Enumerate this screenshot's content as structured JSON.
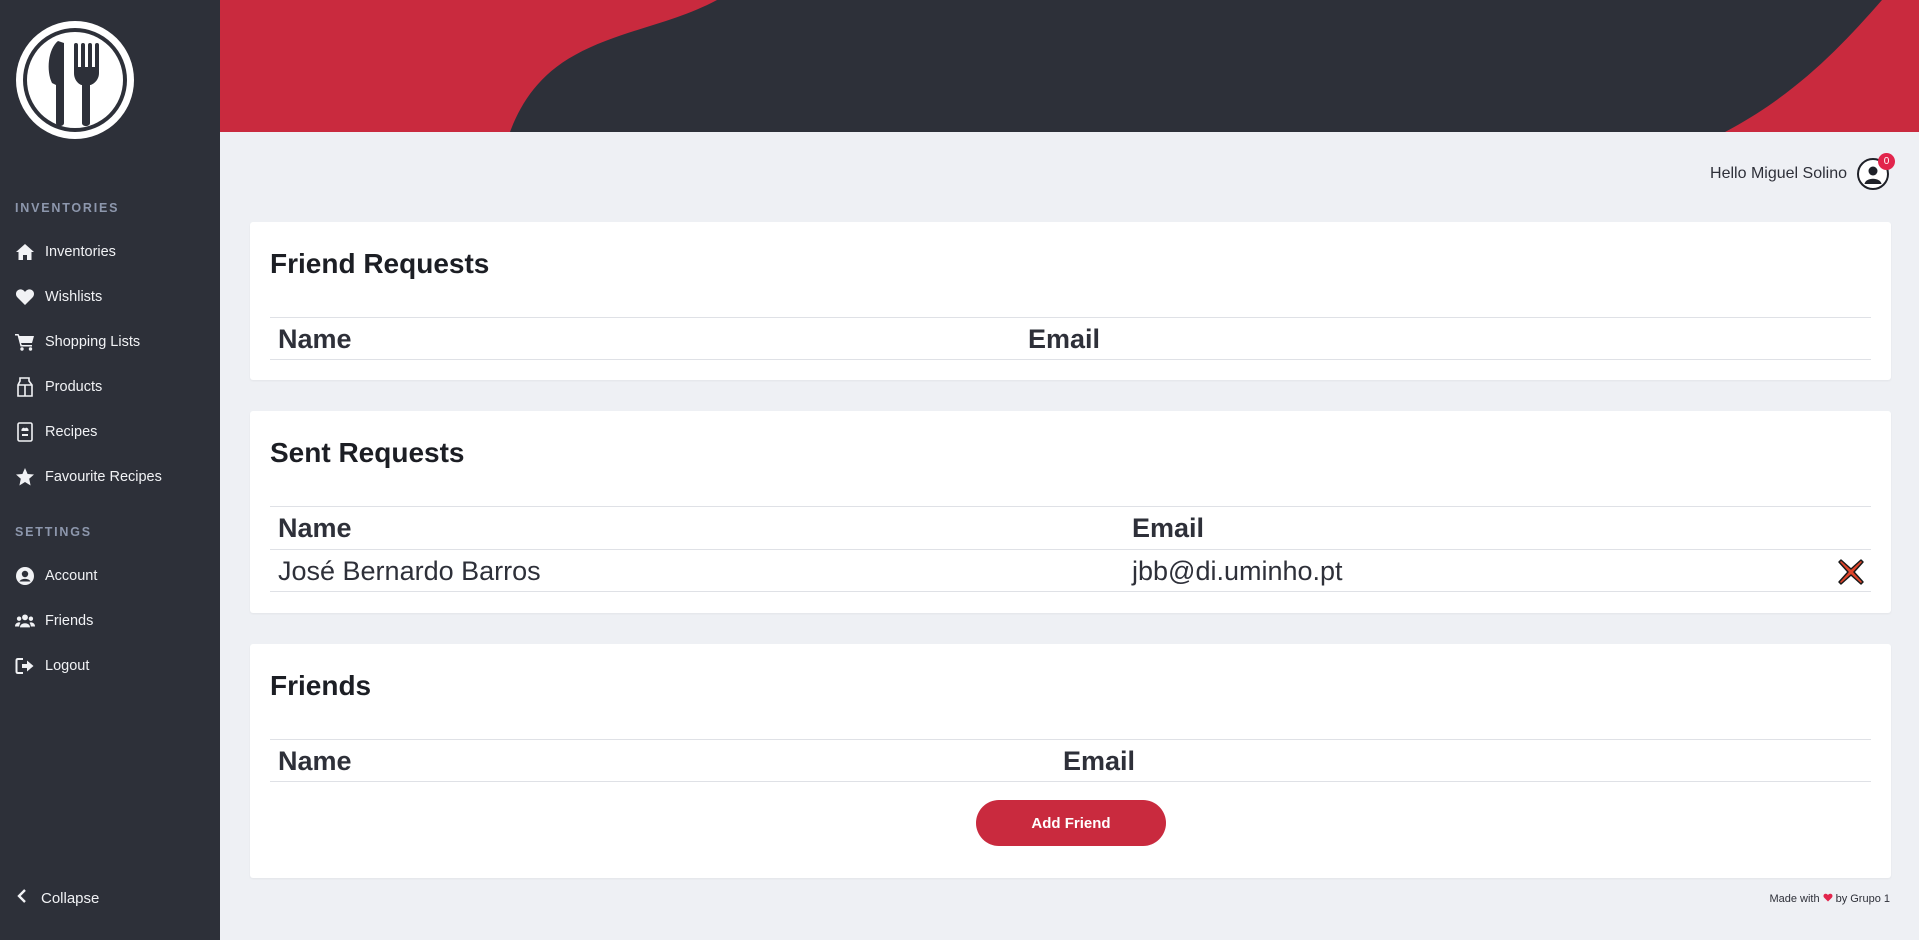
{
  "colors": {
    "sidebar_bg": "#2d3039",
    "accent": "#c92a3e",
    "page_bg": "#eef0f4",
    "badge": "#e2254c"
  },
  "sidebar": {
    "logo_icon": "fork-knife-logo-icon",
    "sections": [
      {
        "title": "INVENTORIES",
        "items": [
          {
            "label": "Inventories",
            "icon": "home-icon"
          },
          {
            "label": "Wishlists",
            "icon": "heart-icon"
          },
          {
            "label": "Shopping Lists",
            "icon": "cart-icon"
          },
          {
            "label": "Products",
            "icon": "milk-carton-icon"
          },
          {
            "label": "Recipes",
            "icon": "recipe-book-icon"
          },
          {
            "label": "Favourite Recipes",
            "icon": "star-icon"
          }
        ]
      },
      {
        "title": "SETTINGS",
        "items": [
          {
            "label": "Account",
            "icon": "user-circle-icon"
          },
          {
            "label": "Friends",
            "icon": "users-icon"
          },
          {
            "label": "Logout",
            "icon": "logout-icon"
          }
        ]
      }
    ],
    "collapse_label": "Collapse"
  },
  "header": {
    "greeting": "Hello Miguel Solino",
    "notification_count": "0"
  },
  "friend_requests": {
    "title": "Friend Requests",
    "columns": [
      "Name",
      "Email"
    ],
    "rows": []
  },
  "sent_requests": {
    "title": "Sent Requests",
    "columns": [
      "Name",
      "Email"
    ],
    "rows": [
      {
        "name": "José Bernardo Barros",
        "email": "jbb@di.uminho.pt"
      }
    ]
  },
  "friends": {
    "title": "Friends",
    "columns": [
      "Name",
      "Email"
    ],
    "rows": [],
    "add_button_label": "Add Friend"
  },
  "footer": {
    "made_with": "Made with",
    "by": "by Grupo 1"
  }
}
